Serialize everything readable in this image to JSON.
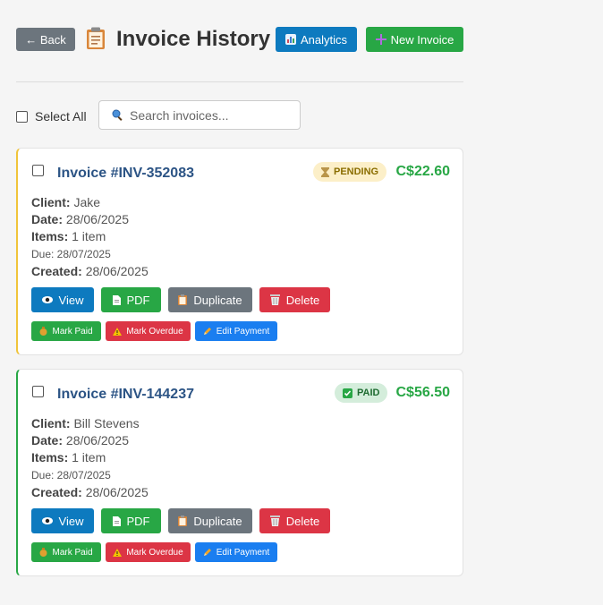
{
  "header": {
    "back_label": "← Back",
    "title": "Invoice History",
    "analytics_label": "Analytics",
    "new_invoice_label": "New Invoice"
  },
  "toolbar": {
    "select_all_label": "Select All",
    "search_placeholder": "Search invoices..."
  },
  "labels": {
    "client": "Client:",
    "date": "Date:",
    "items": "Items:",
    "created": "Created:",
    "view": "View",
    "pdf": "PDF",
    "duplicate": "Duplicate",
    "delete": "Delete",
    "mark_paid": "Mark Paid",
    "mark_overdue": "Mark Overdue",
    "edit_payment": "Edit Payment"
  },
  "invoices": [
    {
      "title": "Invoice #INV-352083",
      "status": "PENDING",
      "status_color": "#f0c43a",
      "amount": "C$22.60",
      "client": "Jake",
      "date": "28/06/2025",
      "items": "1 item",
      "due": "Due: 28/07/2025",
      "created": "28/06/2025"
    },
    {
      "title": "Invoice #INV-144237",
      "status": "PAID",
      "status_color": "#28a745",
      "amount": "C$56.50",
      "client": "Bill Stevens",
      "date": "28/06/2025",
      "items": "1 item",
      "due": "Due: 28/07/2025",
      "created": "28/06/2025"
    }
  ]
}
